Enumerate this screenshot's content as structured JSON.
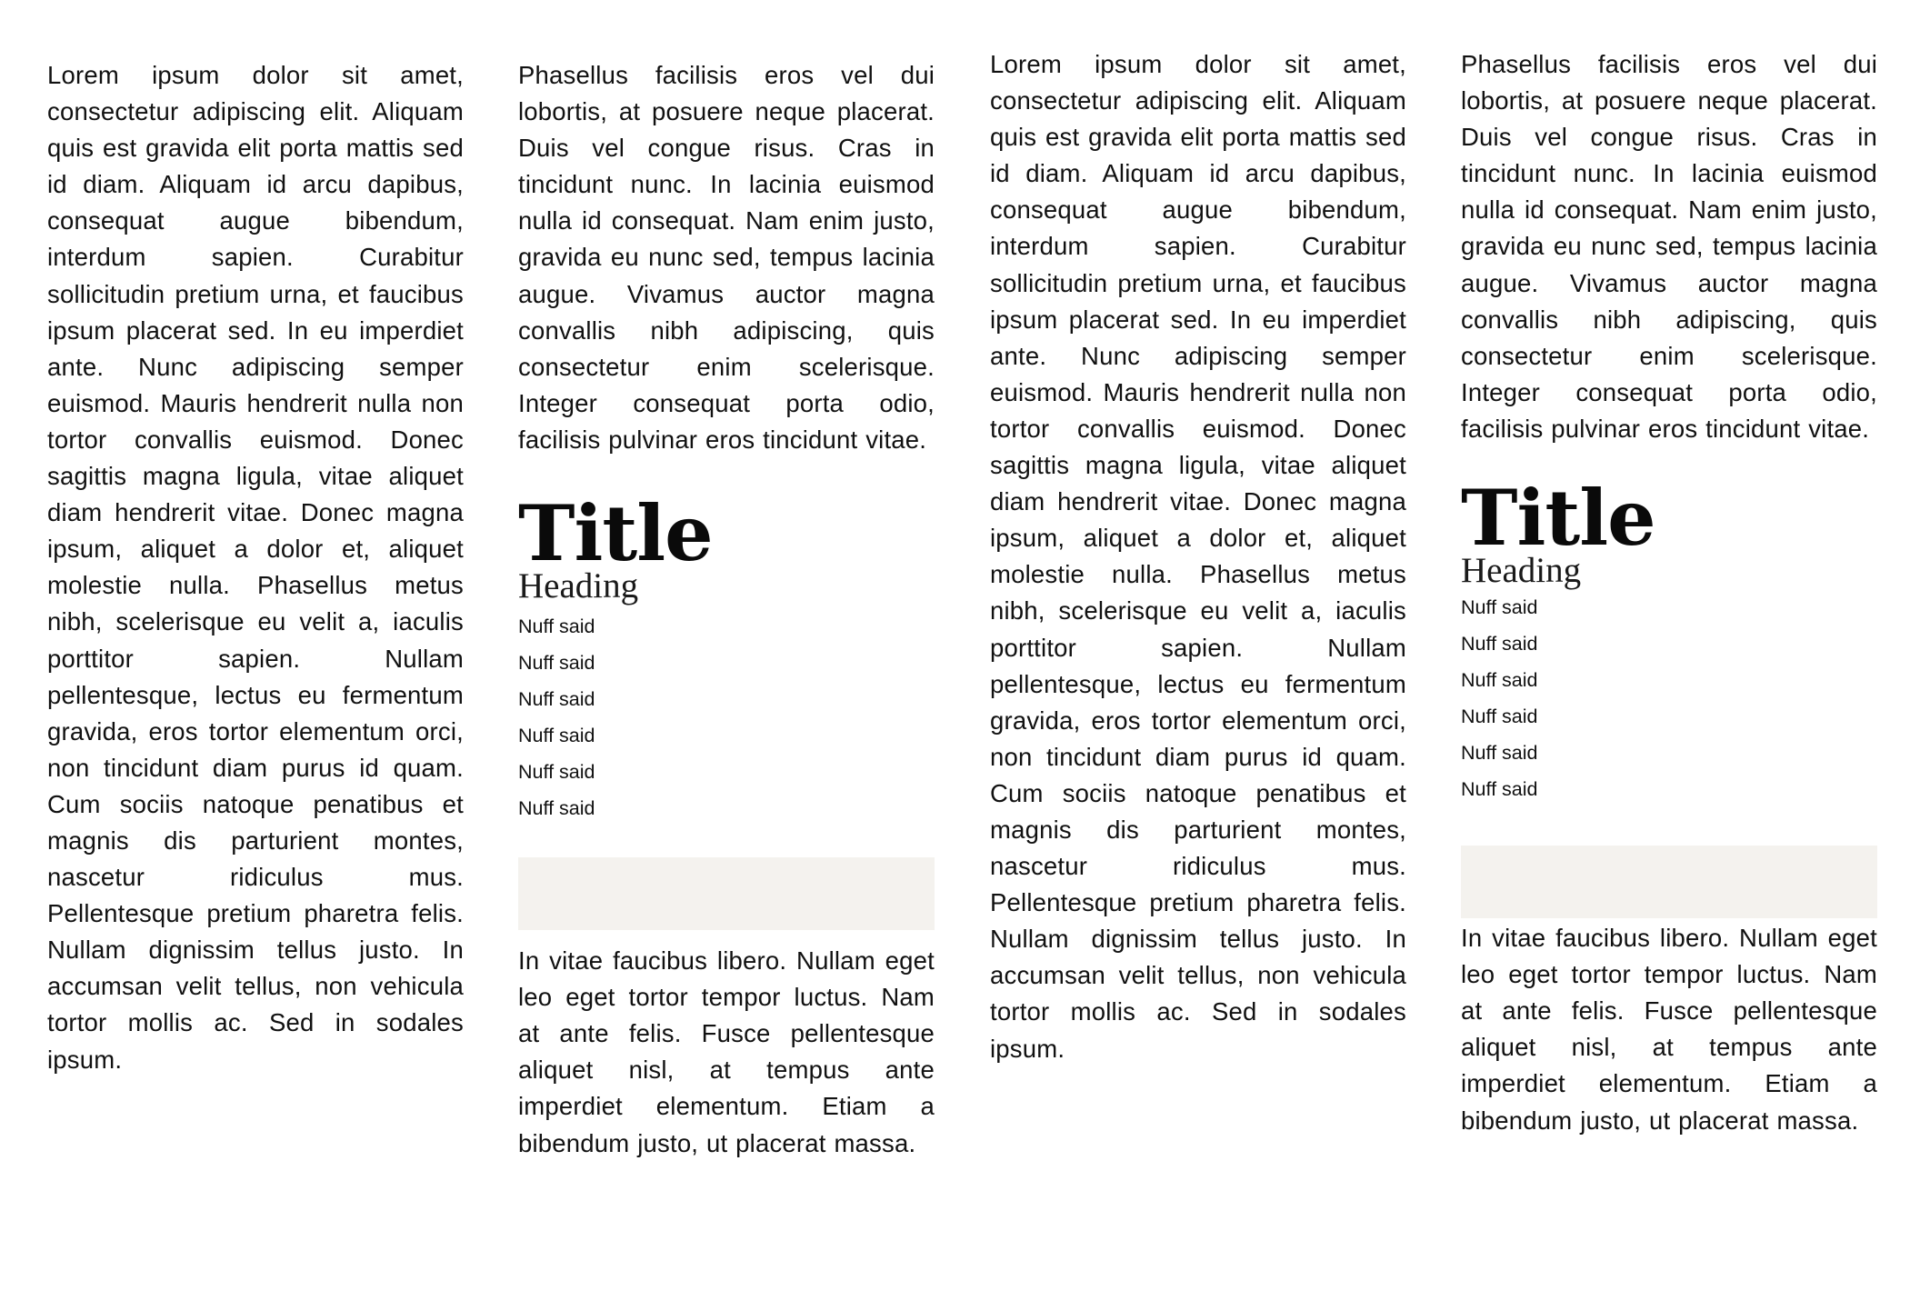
{
  "columns": [
    {
      "paragraphs": [
        "Lorem ipsum dolor sit amet, consectetur adipiscing elit. Aliquam quis est gravida elit porta mattis sed id diam. Aliquam id arcu dapibus, consequat augue bibendum, interdum sapien. Curabitur sollicitudin pretium urna, et faucibus ipsum placerat sed. In eu imperdiet ante. Nunc adipiscing semper euismod. Mauris hendrerit nulla non tortor convallis euismod. Donec sagittis magna ligula, vitae aliquet diam hendrerit vitae. Donec magna ipsum, aliquet a dolor et, aliquet molestie nulla. Phasellus metus nibh, scelerisque eu velit a, iaculis porttitor sapien. Nullam pellentesque, lectus eu fermentum gravida, eros tortor elementum orci, non tincidunt diam purus id quam. Cum sociis natoque penatibus et magnis dis parturient montes, nascetur ridiculus mus. Pellentesque pretium pharetra felis. Nullam dignissim tellus justo. In accumsan velit tellus, non vehicula tortor mollis ac. Sed in sodales ipsum."
      ]
    },
    {
      "paragraph_before": "Phasellus facilisis eros vel dui lobortis, at posuere neque placerat. Duis vel congue risus. Cras in tincidunt nunc. In lacinia euismod nulla id consequat. Nam enim justo, gravida eu nunc sed, tempus lacinia augue. Vivamus auctor magna convallis nibh adipiscing, quis consectetur enim scelerisque. Integer consequat porta odio, facilisis pulvinar eros tincidunt vitae.",
      "title": "Title",
      "heading": "Heading",
      "list": [
        "Nuff said",
        "Nuff said",
        "Nuff said",
        "Nuff said",
        "Nuff said",
        "Nuff said"
      ],
      "paragraph_after": "In vitae faucibus libero. Nullam eget leo eget tortor tempor luctus. Nam at ante felis. Fusce pellentesque aliquet nisl, at tempus ante imperdiet elementum. Etiam a bibendum justo, ut placerat massa."
    },
    {
      "paragraphs": [
        "Lorem ipsum dolor sit amet, consectetur adipiscing elit. Aliquam quis est gravida elit porta mattis sed id diam. Aliquam id arcu dapibus, consequat augue bibendum, interdum sapien. Curabitur sollicitudin pretium urna, et faucibus ipsum placerat sed. In eu imperdiet ante. Nunc adipiscing semper euismod. Mauris hendrerit nulla non tortor convallis euismod. Donec sagittis magna ligula, vitae aliquet diam hendrerit vitae. Donec magna ipsum, aliquet a dolor et, aliquet molestie nulla. Phasellus metus nibh, scelerisque eu velit a, iaculis porttitor sapien. Nullam pellentesque, lectus eu fermentum gravida, eros tortor elementum orci, non tincidunt diam purus id quam. Cum sociis natoque penatibus et magnis dis parturient montes, nascetur ridiculus mus. Pellentesque pretium pharetra felis. Nullam dignissim tellus justo. In accumsan velit tellus, non vehicula tortor mollis ac. Sed in sodales ipsum."
      ]
    },
    {
      "paragraph_before": "Phasellus facilisis eros vel dui lobortis, at posuere neque placerat. Duis vel congue risus. Cras in tincidunt nunc. In lacinia euismod nulla id consequat. Nam enim justo, gravida eu nunc sed, tempus lacinia augue. Vivamus auctor magna convallis nibh adipiscing, quis consectetur enim scelerisque. Integer consequat porta odio, facilisis pulvinar eros tincidunt vitae.",
      "title": "Title",
      "heading": "Heading",
      "list": [
        "Nuff said",
        "Nuff said",
        "Nuff said",
        "Nuff said",
        "Nuff said",
        "Nuff said"
      ],
      "paragraph_after": "In vitae faucibus libero. Nullam eget leo eget tortor tempor luctus. Nam at ante felis. Fusce pellentesque aliquet nisl, at tempus ante imperdiet elementum. Etiam a bibendum justo, ut placerat massa."
    }
  ],
  "colors": {
    "text": "#111111",
    "placeholder_box": "#f4f2ee",
    "background": "#ffffff"
  }
}
